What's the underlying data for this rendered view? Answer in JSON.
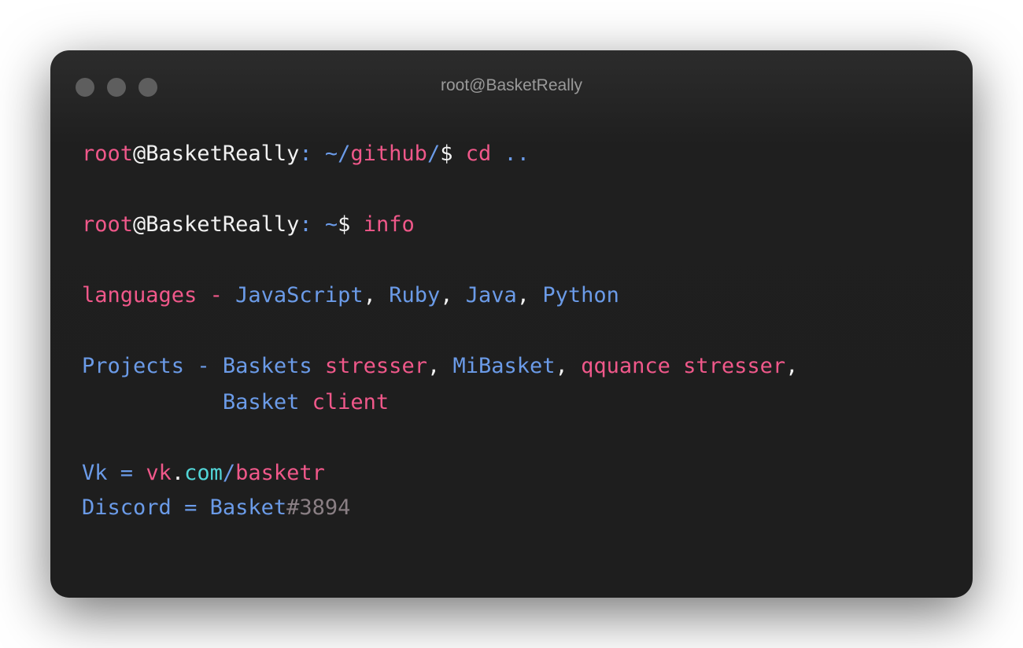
{
  "window": {
    "title": "root@BasketReally",
    "colors": {
      "background": "#1e1e1e",
      "accent_pink": "#f0588a",
      "accent_blue": "#6b9be8",
      "accent_cyan": "#52d6d8",
      "text_white": "#f2f2f2",
      "muted_gray": "#8a7f84"
    }
  },
  "terminal": {
    "line1": {
      "user": "root",
      "host": "@BasketReally",
      "sep": ":",
      "tilde": "~/",
      "dir": "github",
      "slash": "/",
      "prompt": "$",
      "command": "cd",
      "arg": ".."
    },
    "line2": {
      "user": "root",
      "host": "@BasketReally",
      "sep": ":",
      "tilde": "~",
      "prompt": "$",
      "command": "info"
    },
    "languages": {
      "label": "languages",
      "dash": "-",
      "items": [
        "JavaScript",
        "Ruby",
        "Java",
        "Python"
      ],
      "comma": ","
    },
    "projects": {
      "label": "Projects",
      "dash": "-",
      "p1a": "Baskets",
      "p1b": "stresser",
      "p2": "MiBasket",
      "p3a": "qquance",
      "p3b": "stresser",
      "p4a": "Basket",
      "p4b": "client",
      "comma": ","
    },
    "vk": {
      "label": "Vk",
      "eq": "=",
      "domain": "vk",
      "dot": ".",
      "tld": "com",
      "slash": "/",
      "path": "basketr"
    },
    "discord": {
      "label": "Discord",
      "eq": "=",
      "name": "Basket",
      "tag": "#3894"
    }
  }
}
